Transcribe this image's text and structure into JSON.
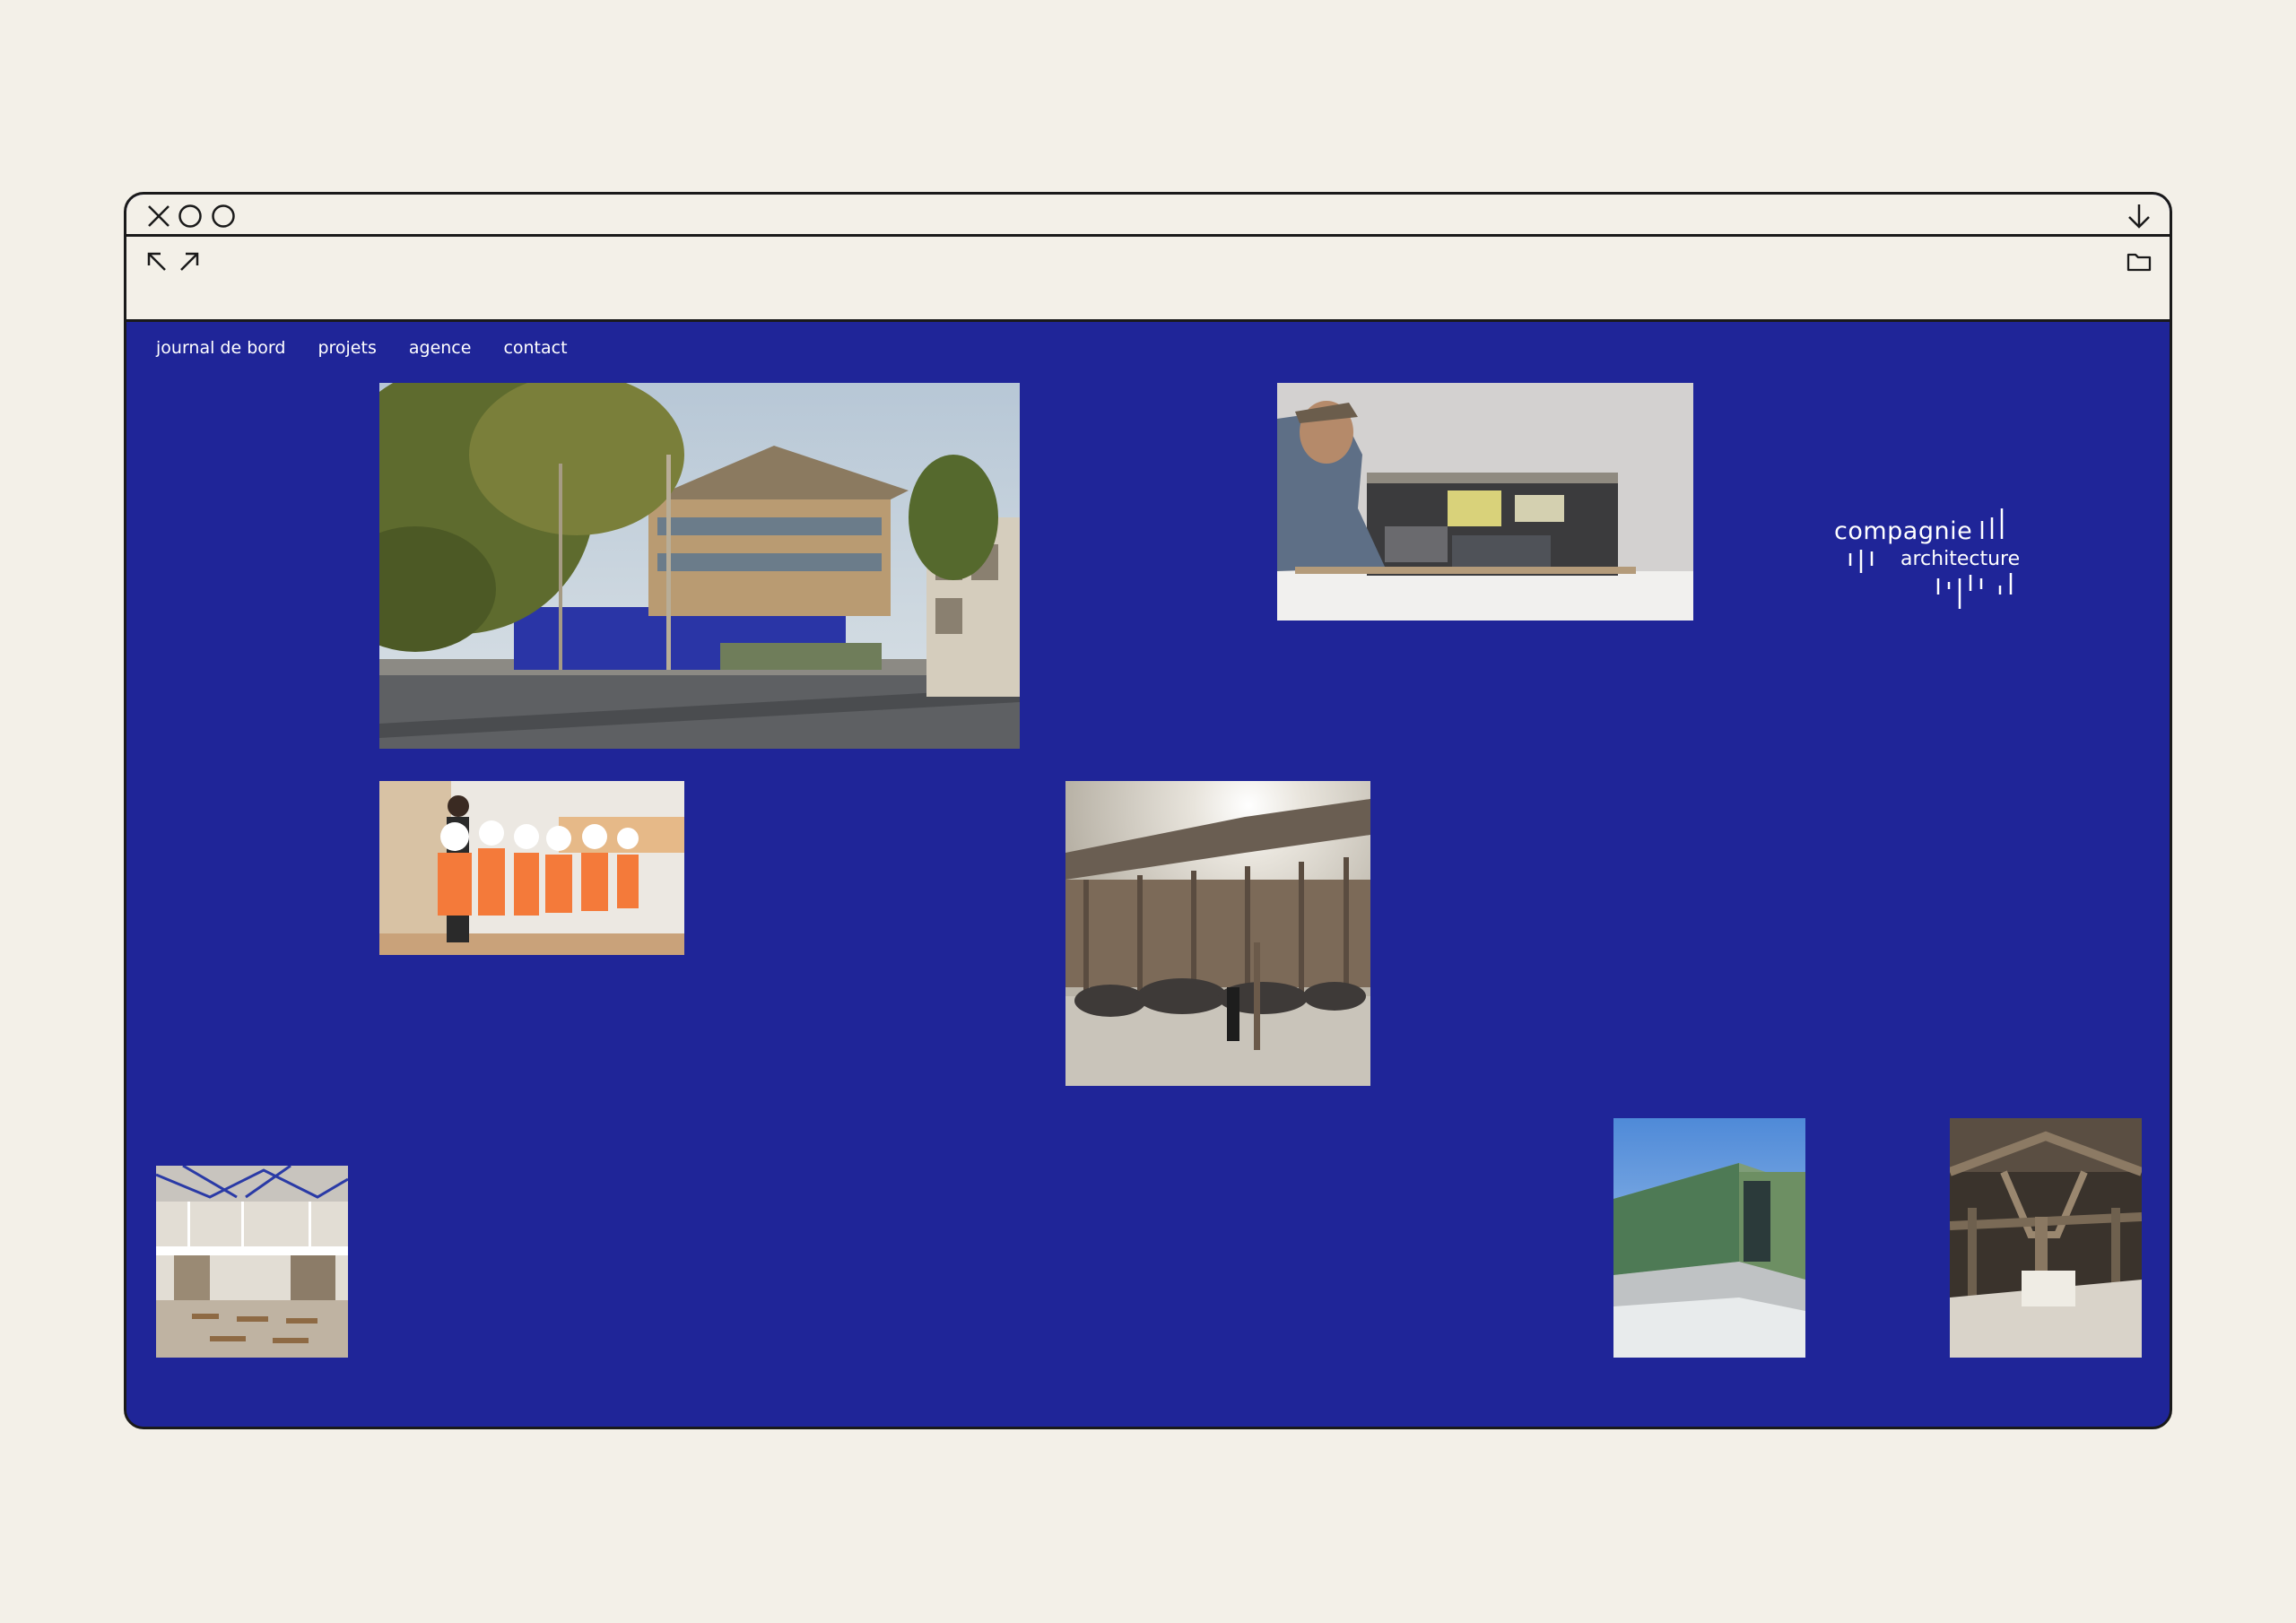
{
  "colors": {
    "background": "#f3f0e8",
    "site": "#1f2598",
    "frame": "#1a1a1a",
    "text": "#ffffff"
  },
  "titlebar": {
    "icons": [
      "close-icon",
      "circle-icon",
      "circle-icon"
    ],
    "right_icon": "arrow-down-icon"
  },
  "toolbar": {
    "icons": [
      "arrow-up-left-icon",
      "arrow-up-right-icon"
    ],
    "right_icon": "folder-icon"
  },
  "nav": {
    "items": [
      "journal de bord",
      "projets",
      "agence",
      "contact"
    ]
  },
  "logo": {
    "line1": "compagnie",
    "line2": "architecture"
  },
  "photos": [
    {
      "subject": "building rendering street view"
    },
    {
      "subject": "person with architectural model"
    },
    {
      "subject": "children in hard hats and orange vests"
    },
    {
      "subject": "gathering in timber courtyard"
    },
    {
      "subject": "interior hall with tables"
    },
    {
      "subject": "green clad building corner"
    },
    {
      "subject": "timber structure interior"
    }
  ]
}
